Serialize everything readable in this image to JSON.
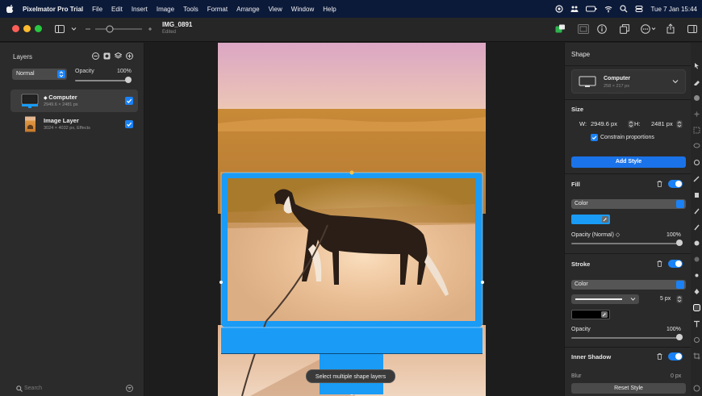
{
  "menubar": {
    "items": [
      "Pixelmator Pro Trial",
      "File",
      "Edit",
      "Insert",
      "Image",
      "Tools",
      "Format",
      "Arrange",
      "View",
      "Window",
      "Help"
    ],
    "clock": "Tue 7 Jan  15:44"
  },
  "document": {
    "title": "IMG_0891",
    "status": "Edited"
  },
  "layers_panel": {
    "title": "Layers",
    "blend_mode": "Normal",
    "opacity_label": "Opacity",
    "opacity_value": "100%",
    "opacity_fraction": 1.0,
    "layers": [
      {
        "name": "Computer",
        "meta": "2949.6 × 2481 px",
        "selected": true,
        "visible": true
      },
      {
        "name": "Image Layer",
        "meta": "3024 × 4032 px, Effects",
        "selected": false,
        "visible": true
      }
    ],
    "search_placeholder": "Search"
  },
  "canvas": {
    "tooltip": "Select multiple shape layers"
  },
  "inspector": {
    "title": "Shape",
    "shape_name": "Computer",
    "shape_size": "258 × 217 px",
    "size_title": "Size",
    "width_label": "W:",
    "width_value": "2949.6 px",
    "height_label": "H:",
    "height_value": "2481 px",
    "constrain_label": "Constrain proportions",
    "add_style": "Add Style",
    "fill_title": "Fill",
    "fill_type": "Color",
    "fill_color": "#1a9bf5",
    "fill_opacity_label": "Opacity (Normal) ◇",
    "fill_opacity_value": "100%",
    "stroke_title": "Stroke",
    "stroke_type": "Color",
    "stroke_width": "5 px",
    "stroke_color": "#000000",
    "stroke_opacity_label": "Opacity",
    "stroke_opacity_value": "100%",
    "inner_shadow_title": "Inner Shadow",
    "blur_label": "Blur",
    "blur_value": "0 px",
    "reset_style": "Reset Style"
  },
  "colors": {
    "accent": "#1a82f6",
    "shape_blue": "#1a9bf5"
  }
}
